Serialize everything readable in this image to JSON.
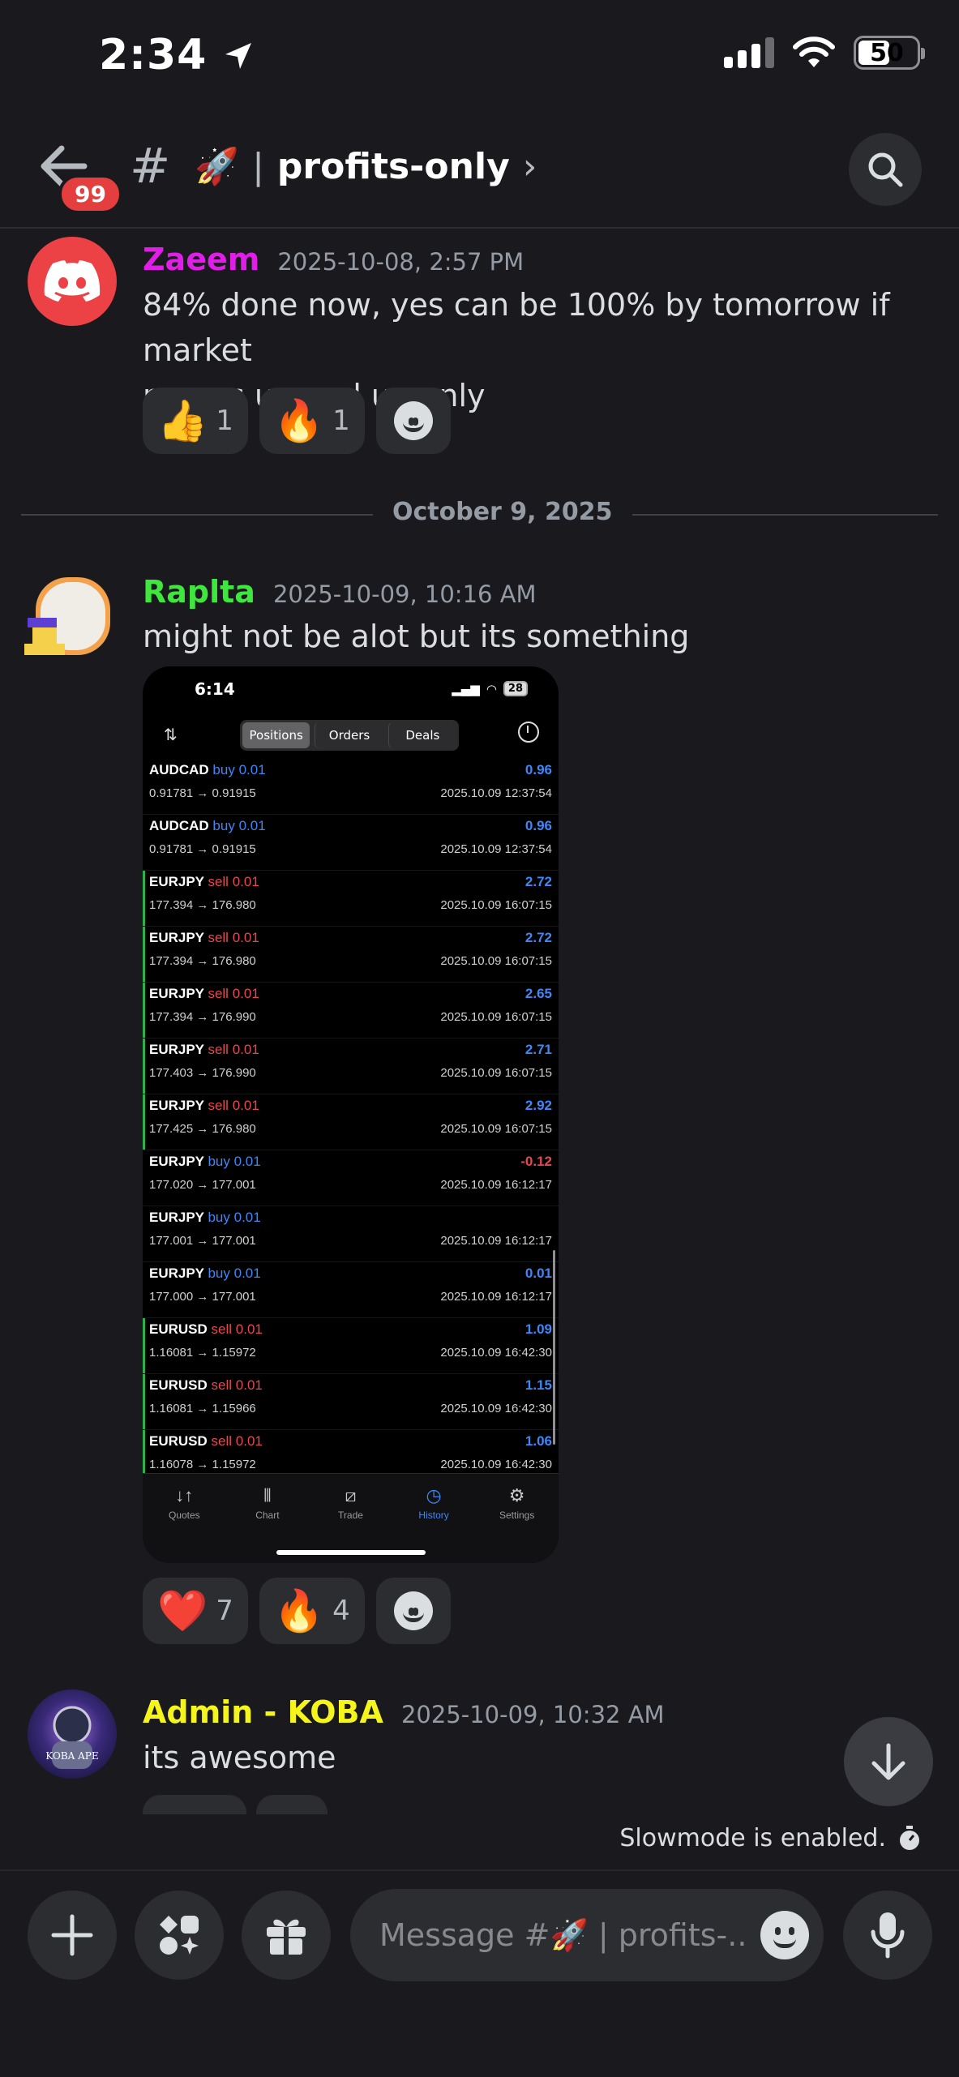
{
  "status_bar": {
    "time": "2:34",
    "battery": "50"
  },
  "header": {
    "unread_badge": "99",
    "channel_hash": "#",
    "channel_emoji": "🚀",
    "channel_separator": "|",
    "channel_name": "profits-only",
    "chevron": "›"
  },
  "messages": [
    {
      "author": "Zaeem",
      "author_color": "#e11de8",
      "timestamp": "2025-10-08, 2:57 PM",
      "text_line1": "84% done now, yes can be 100% by tomorrow if market",
      "text_line2": "moves up and up only",
      "reactions": [
        {
          "emoji": "👍",
          "count": "1"
        },
        {
          "emoji": "🔥",
          "count": "1"
        }
      ]
    },
    {
      "author": "Raplta",
      "author_color": "#3ee63e",
      "timestamp": "2025-10-09, 10:16 AM",
      "text": "might not be alot but its something",
      "reactions": [
        {
          "emoji": "❤️",
          "count": "7"
        },
        {
          "emoji": "🔥",
          "count": "4"
        }
      ]
    },
    {
      "author": "Admin - KOBA",
      "author_color": "#f5f51c",
      "timestamp": "2025-10-09, 10:32 AM",
      "text": "its awesome"
    }
  ],
  "date_divider": "October 9, 2025",
  "screenshot": {
    "time": "6:14",
    "battery": "28",
    "tabs": [
      "Positions",
      "Orders",
      "Deals"
    ],
    "active_tab": "Positions",
    "trades": [
      {
        "symbol": "AUDCAD",
        "side": "buy",
        "lot": "0.01",
        "prices": "0.91781 → 0.91915",
        "pnl": "0.96",
        "datetime": "2025.10.09 12:37:54",
        "bar": false
      },
      {
        "symbol": "AUDCAD",
        "side": "buy",
        "lot": "0.01",
        "prices": "0.91781 → 0.91915",
        "pnl": "0.96",
        "datetime": "2025.10.09 12:37:54",
        "bar": false
      },
      {
        "symbol": "EURJPY",
        "side": "sell",
        "lot": "0.01",
        "prices": "177.394 → 176.980",
        "pnl": "2.72",
        "datetime": "2025.10.09 16:07:15",
        "bar": true
      },
      {
        "symbol": "EURJPY",
        "side": "sell",
        "lot": "0.01",
        "prices": "177.394 → 176.980",
        "pnl": "2.72",
        "datetime": "2025.10.09 16:07:15",
        "bar": true
      },
      {
        "symbol": "EURJPY",
        "side": "sell",
        "lot": "0.01",
        "prices": "177.394 → 176.990",
        "pnl": "2.65",
        "datetime": "2025.10.09 16:07:15",
        "bar": true
      },
      {
        "symbol": "EURJPY",
        "side": "sell",
        "lot": "0.01",
        "prices": "177.403 → 176.990",
        "pnl": "2.71",
        "datetime": "2025.10.09 16:07:15",
        "bar": true
      },
      {
        "symbol": "EURJPY",
        "side": "sell",
        "lot": "0.01",
        "prices": "177.425 → 176.980",
        "pnl": "2.92",
        "datetime": "2025.10.09 16:07:15",
        "bar": true
      },
      {
        "symbol": "EURJPY",
        "side": "buy",
        "lot": "0.01",
        "prices": "177.020 → 177.001",
        "pnl": "-0.12",
        "datetime": "2025.10.09 16:12:17",
        "bar": false
      },
      {
        "symbol": "EURJPY",
        "side": "buy",
        "lot": "0.01",
        "prices": "177.001 → 177.001",
        "pnl": "",
        "datetime": "2025.10.09 16:12:17",
        "bar": false
      },
      {
        "symbol": "EURJPY",
        "side": "buy",
        "lot": "0.01",
        "prices": "177.000 → 177.001",
        "pnl": "0.01",
        "datetime": "2025.10.09 16:12:17",
        "bar": false
      },
      {
        "symbol": "EURUSD",
        "side": "sell",
        "lot": "0.01",
        "prices": "1.16081 → 1.15972",
        "pnl": "1.09",
        "datetime": "2025.10.09 16:42:30",
        "bar": true
      },
      {
        "symbol": "EURUSD",
        "side": "sell",
        "lot": "0.01",
        "prices": "1.16081 → 1.15966",
        "pnl": "1.15",
        "datetime": "2025.10.09 16:42:30",
        "bar": true
      },
      {
        "symbol": "EURUSD",
        "side": "sell",
        "lot": "0.01",
        "prices": "1.16078 → 1.15972",
        "pnl": "1.06",
        "datetime": "2025.10.09 16:42:30",
        "bar": true
      }
    ],
    "nav": [
      {
        "label": "Quotes",
        "icon": "↓↑"
      },
      {
        "label": "Chart",
        "icon": "⫴"
      },
      {
        "label": "Trade",
        "icon": "⧄"
      },
      {
        "label": "History",
        "icon": "◷",
        "active": true
      },
      {
        "label": "Settings",
        "icon": "⚙"
      }
    ]
  },
  "slowmode_text": "Slowmode is enabled.",
  "composer": {
    "placeholder": "Message #🚀 | profits-.."
  },
  "colors": {
    "background": "#1a1a1e",
    "surface": "#2b2d31",
    "badge": "#e53e3e",
    "discord_blurple": "#ed4245"
  }
}
